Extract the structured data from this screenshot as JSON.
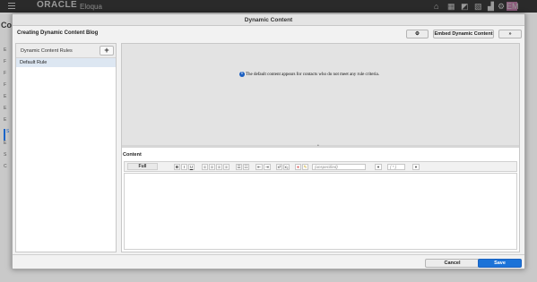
{
  "app": {
    "brand": "ORACLE",
    "product": "Eloqua",
    "user_initials": "EM",
    "background_title": "Co",
    "background_nav": [
      "E",
      "F",
      "F",
      "F",
      "E",
      "E",
      "E",
      "S",
      "E",
      "S",
      "C"
    ]
  },
  "top_icons": [
    "home-icon",
    "grid-icon",
    "chart-icon",
    "image-icon",
    "bar-chart-icon",
    "gear-icon",
    "search-icon"
  ],
  "modal": {
    "title": "Dynamic Content",
    "subtitle": "Creating Dynamic Content Blog",
    "settings_label": "⚙",
    "embed_label": "Embed Dynamic Content",
    "expand_label": "»"
  },
  "rules": {
    "header": "Dynamic Content Rules",
    "add_label": "+",
    "items": [
      {
        "label": "Default Rule"
      }
    ]
  },
  "preview": {
    "info_text": "The default content appears for contacts who do not meet any rule criteria."
  },
  "editor": {
    "label": "Content",
    "mode": "Full",
    "font_select": "(unspecified)",
    "size_select": "( * )",
    "toolbar": [
      "B",
      "I",
      "U"
    ]
  },
  "footer": {
    "cancel_label": "Cancel",
    "save_label": "Save"
  },
  "colors": {
    "accent": "#1b73d8",
    "topbar": "#2a2a2a",
    "selected_rule": "#dde7f2"
  }
}
